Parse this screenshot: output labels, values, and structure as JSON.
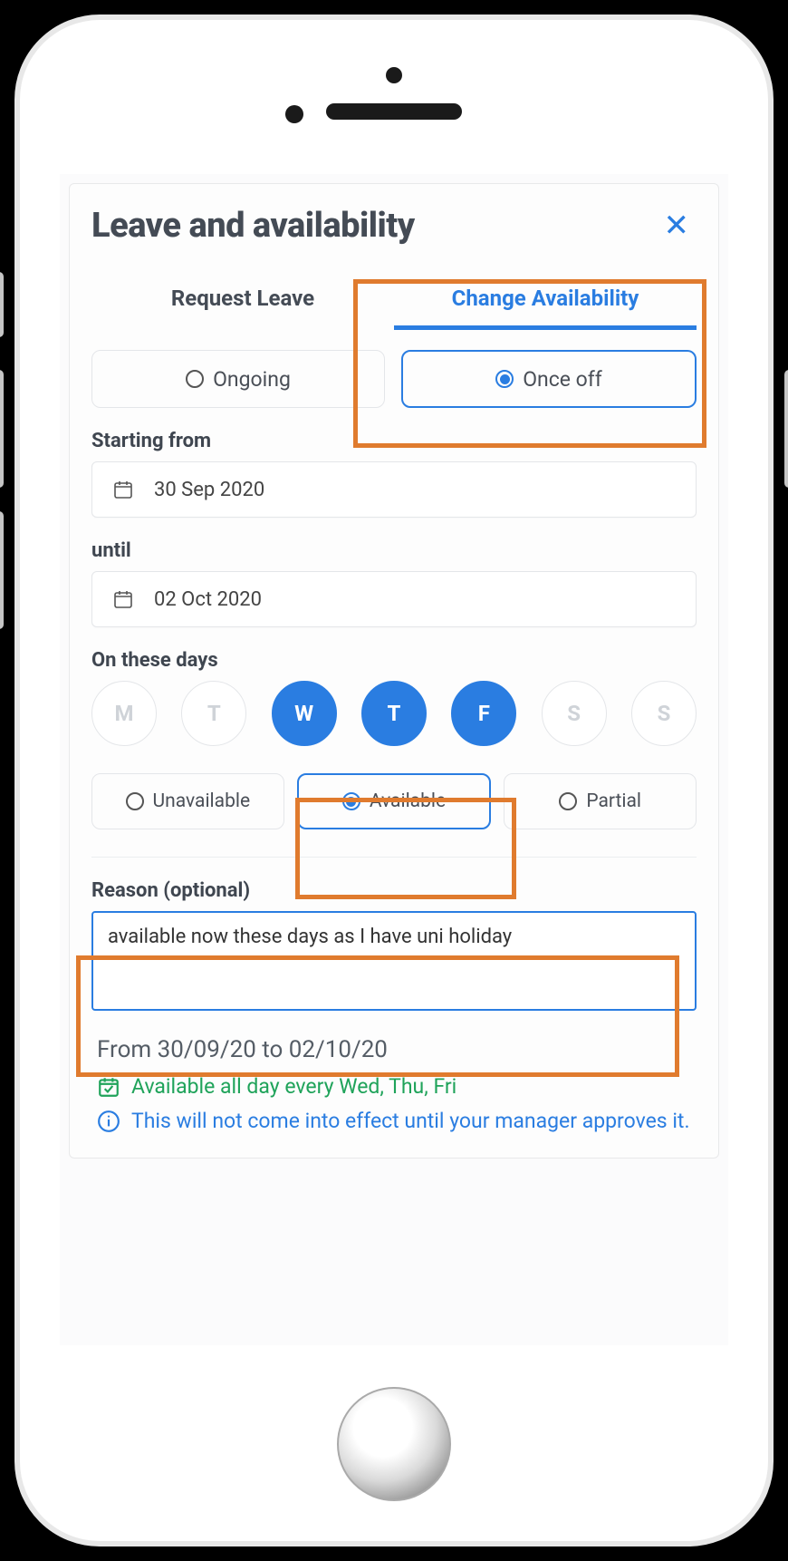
{
  "panel": {
    "title": "Leave and availability"
  },
  "tabs": {
    "request_leave": "Request Leave",
    "change_availability": "Change Availability"
  },
  "frequency": {
    "ongoing": "Ongoing",
    "once_off": "Once off"
  },
  "labels": {
    "starting_from": "Starting from",
    "until": "until",
    "on_these_days": "On these days",
    "reason": "Reason (optional)"
  },
  "dates": {
    "start": "30 Sep 2020",
    "end": "02 Oct 2020"
  },
  "days": [
    {
      "abbr": "M",
      "selected": false
    },
    {
      "abbr": "T",
      "selected": false
    },
    {
      "abbr": "W",
      "selected": true
    },
    {
      "abbr": "T",
      "selected": true
    },
    {
      "abbr": "F",
      "selected": true
    },
    {
      "abbr": "S",
      "selected": false
    },
    {
      "abbr": "S",
      "selected": false
    }
  ],
  "availability": {
    "unavailable": "Unavailable",
    "available": "Available",
    "partial": "Partial"
  },
  "reason_text": "available now these days as I have uni holiday",
  "summary": {
    "range": "From 30/09/20 to 02/10/20",
    "available_line": "Available all day every Wed, Thu, Fri",
    "info_line": "This will not come into effect until your manager approves it."
  }
}
